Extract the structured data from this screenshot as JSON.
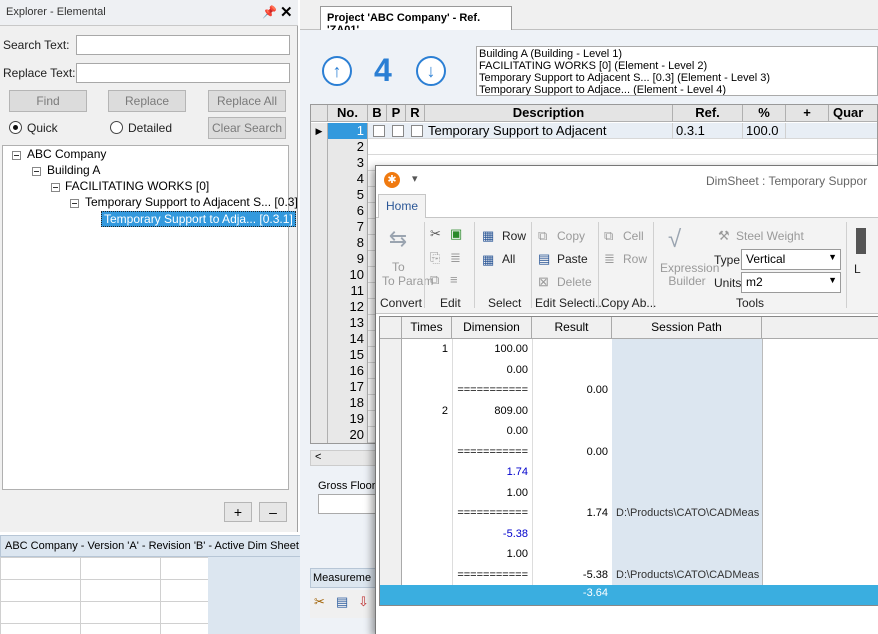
{
  "explorer": {
    "title": "Explorer - Elemental",
    "search_label": "Search Text:",
    "replace_label": "Replace Text:",
    "search_value": "",
    "replace_value": "",
    "find_label": "Find",
    "replace_btn_label": "Replace",
    "replace_all_label": "Replace All",
    "clear_search_label": "Clear Search",
    "quick_label": "Quick",
    "detailed_label": "Detailed",
    "tree": [
      {
        "label": "ABC Company"
      },
      {
        "label": "Building A"
      },
      {
        "label": "FACILITATING WORKS [0]"
      },
      {
        "label": "Temporary Support to Adjacent S... [0.3]"
      },
      {
        "label": "Temporary Support to Adja... [0.3.1]"
      }
    ],
    "add_label": "+",
    "remove_label": "–"
  },
  "status": {
    "text": "ABC Company - Version 'A' - Revision 'B' -  Active Dim Sheet"
  },
  "document": {
    "tab_label": "Project 'ABC Company' - Ref. 'ZA01' ...",
    "level": "4",
    "up_icon": "arrow-up-circle-icon",
    "down_icon": "arrow-down-circle-icon",
    "breadcrumb": [
      "Building A (Building - Level 1)",
      "FACILITATING WORKS [0] (Element - Level 2)",
      "Temporary Support to Adjacent S... [0.3] (Element - Level 3)",
      "Temporary Support to Adjace... (Element - Level 4)"
    ],
    "columns": [
      "No.",
      "B",
      "P",
      "R",
      "Description",
      "Ref.",
      "%",
      "+",
      "Quar"
    ],
    "rows": [
      {
        "no": "1",
        "description": "Temporary Support to Adjacent",
        "ref": "0.3.1",
        "percent": "100.0"
      },
      {
        "no": "2"
      },
      {
        "no": "3"
      },
      {
        "no": "4"
      },
      {
        "no": "5"
      },
      {
        "no": "6"
      },
      {
        "no": "7"
      },
      {
        "no": "8"
      },
      {
        "no": "9"
      },
      {
        "no": "10"
      },
      {
        "no": "11"
      },
      {
        "no": "12"
      },
      {
        "no": "13"
      },
      {
        "no": "14"
      },
      {
        "no": "15"
      },
      {
        "no": "16"
      },
      {
        "no": "17"
      },
      {
        "no": "18"
      },
      {
        "no": "19"
      },
      {
        "no": "20"
      }
    ],
    "gross_floor_label": "Gross Floor",
    "measurement_tab": "Measureme"
  },
  "dimsheet": {
    "title": "DimSheet : Temporary Suppor",
    "home_tab": "Home",
    "ribbon": {
      "to_param": "To Param",
      "convert": "Convert",
      "edit": "Edit",
      "row": "Row",
      "all": "All",
      "select": "Select",
      "copy": "Copy",
      "paste": "Paste",
      "delete": "Delete",
      "edit_selection": "Edit Selecti...",
      "cell": "Cell",
      "row2": "Row",
      "copy_above": "Copy Ab...",
      "expression_builder": "Expression Builder",
      "steel_weight": "Steel Weight",
      "type_label": "Type",
      "type_value": "Vertical",
      "units_label": "Units",
      "units_value": "m2",
      "tools": "Tools",
      "lo": "L"
    },
    "columns": [
      "Times",
      "Dimension",
      "Result",
      "Session Path"
    ],
    "rows": [
      {
        "times": "1",
        "dimension": "100.00",
        "result": "",
        "path": ""
      },
      {
        "times": "",
        "dimension": "0.00",
        "result": "",
        "path": ""
      },
      {
        "times": "",
        "dimension": "===========",
        "result": "0.00",
        "path": ""
      },
      {
        "times": "2",
        "dimension": "809.00",
        "result": "",
        "path": ""
      },
      {
        "times": "",
        "dimension": "0.00",
        "result": "",
        "path": ""
      },
      {
        "times": "",
        "dimension": "===========",
        "result": "0.00",
        "path": ""
      },
      {
        "times": "",
        "dimension": "1.74",
        "result": "",
        "path": ""
      },
      {
        "times": "",
        "dimension": "1.00",
        "result": "",
        "path": ""
      },
      {
        "times": "",
        "dimension": "===========",
        "result": "1.74",
        "path": "D:\\Products\\CATO\\CADMeas"
      },
      {
        "times": "",
        "dimension": "-5.38",
        "result": "",
        "path": ""
      },
      {
        "times": "",
        "dimension": "1.00",
        "result": "",
        "path": ""
      },
      {
        "times": "",
        "dimension": "===========",
        "result": "-5.38",
        "path": "D:\\Products\\CATO\\CADMeas"
      }
    ],
    "total": "-3.64"
  }
}
